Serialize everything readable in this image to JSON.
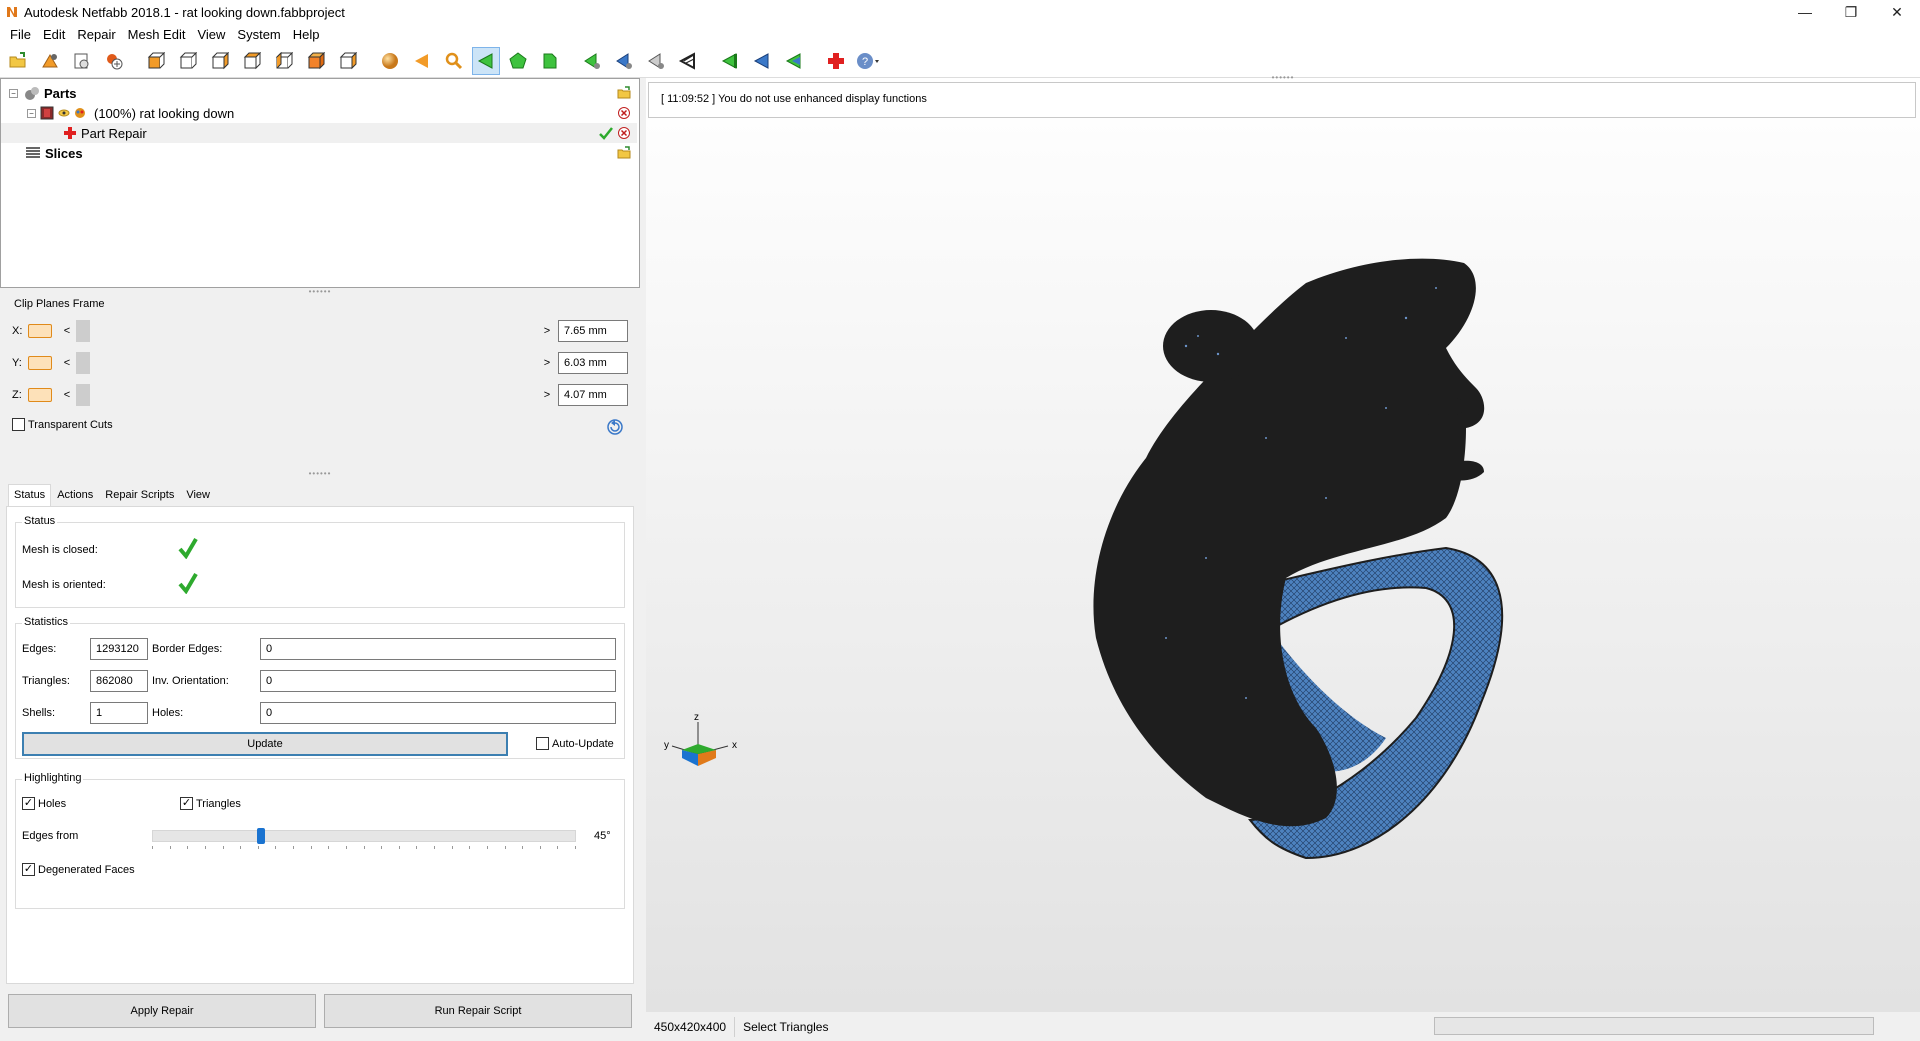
{
  "window": {
    "title": "Autodesk Netfabb 2018.1 - rat looking down.fabbproject",
    "controls": [
      "minimize-icon",
      "restore-icon",
      "close-icon"
    ]
  },
  "menu": [
    "File",
    "Edit",
    "Repair",
    "Mesh Edit",
    "View",
    "System",
    "Help"
  ],
  "toolbar": {
    "icons": [
      "open-project-icon",
      "add-part-icon",
      "import-icon",
      "new-part-icon",
      "view-front-icon",
      "view-back-icon",
      "view-left-icon",
      "view-right-icon",
      "view-top-icon",
      "view-bottom-icon",
      "view-iso-icon",
      "sphere-shading-icon",
      "arrow-left-icon",
      "zoom-icon",
      "select-triangles-icon",
      "select-surface-icon",
      "select-shell-icon",
      "select-tool-a-icon",
      "select-tool-b-icon",
      "select-tool-c-icon",
      "select-tool-d-icon",
      "invert-select-icon",
      "shift-select-icon",
      "extend-select-icon",
      "repair-icon",
      "help-dropdown-icon"
    ]
  },
  "tree": {
    "parts_label": "Parts",
    "part_label": "(100%) rat looking down",
    "repair_label": "Part Repair",
    "slices_label": "Slices"
  },
  "clip": {
    "title": "Clip Planes Frame",
    "rows": [
      {
        "axis": "X:",
        "value": "7.65 mm"
      },
      {
        "axis": "Y:",
        "value": "6.03 mm"
      },
      {
        "axis": "Z:",
        "value": "4.07 mm"
      }
    ],
    "transparent_label": "Transparent Cuts"
  },
  "tabs": [
    "Status",
    "Actions",
    "Repair Scripts",
    "View"
  ],
  "status": {
    "title": "Status",
    "closed_label": "Mesh is closed:",
    "oriented_label": "Mesh is oriented:"
  },
  "statistics": {
    "title": "Statistics",
    "edges_label": "Edges:",
    "edges_value": "1293120",
    "border_edges_label": "Border Edges:",
    "border_edges_value": "0",
    "triangles_label": "Triangles:",
    "triangles_value": "862080",
    "inv_orientation_label": "Inv. Orientation:",
    "inv_orientation_value": "0",
    "shells_label": "Shells:",
    "shells_value": "1",
    "holes_label": "Holes:",
    "holes_value": "0",
    "update_label": "Update",
    "auto_update_label": "Auto-Update"
  },
  "highlighting": {
    "title": "Highlighting",
    "holes_label": "Holes",
    "triangles_label": "Triangles",
    "edges_from_label": "Edges from",
    "edges_from_value": "45°",
    "edges_from_fraction": 0.25,
    "degenerated_label": "Degenerated Faces"
  },
  "buttons": {
    "apply_repair": "Apply Repair",
    "run_script": "Run Repair Script"
  },
  "log": {
    "message": "[ 11:09:52 ] You do not use enhanced display functions"
  },
  "axes": {
    "x": "x",
    "y": "y",
    "z": "z"
  },
  "statusbar": {
    "dimensions": "450x420x400",
    "mode": "Select Triangles"
  },
  "colors": {
    "accent": "#3c7fb1",
    "mesh_dark": "#1e1e1e",
    "mesh_blue": "#4d82bf",
    "check_green": "#2eaa2e"
  }
}
